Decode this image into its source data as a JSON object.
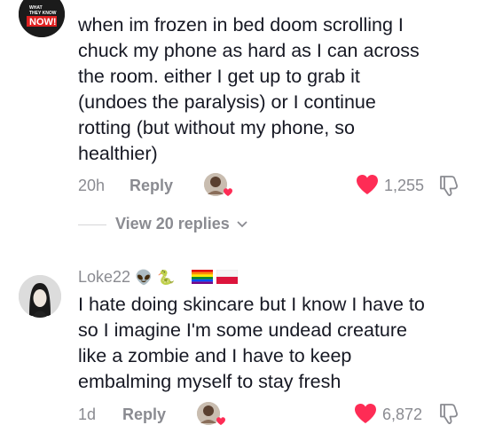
{
  "comment1": {
    "avatar": {
      "logo_text_small": "WHAT\nTHEY KNOW",
      "logo_text": "NOW!",
      "bg": "#1b1b1b",
      "accent": "#e02020"
    },
    "text_lines": [
      "when im frozen in bed doom scrolling I",
      "chuck my phone as hard as I can across",
      "the room. either I get up to grab it",
      "(undoes the paralysis) or I continue",
      "rotting (but without my phone, so",
      "healthier)"
    ],
    "time": "20h",
    "reply_label": "Reply",
    "like_count": "1,255",
    "liked": true
  },
  "view_replies": "View 20 replies",
  "comment2": {
    "username": "Loke22",
    "username_emojis": [
      "👽",
      "🐍",
      "🏳️‍🌈",
      "🇵🇱"
    ],
    "text_lines": [
      "I hate doing skincare but I know I have to",
      "so I imagine I'm some undead creature",
      "like a zombie and I have to keep",
      "embalming myself to stay fresh"
    ],
    "time": "1d",
    "reply_label": "Reply",
    "like_count": "6,872",
    "liked": true
  },
  "colors": {
    "heart": "#fe2c55",
    "muted": "#8a8b91",
    "text": "#161823"
  },
  "icons": [
    "heart-icon",
    "dislike-icon",
    "chevron-down-icon",
    "creator-liked-avatar"
  ]
}
